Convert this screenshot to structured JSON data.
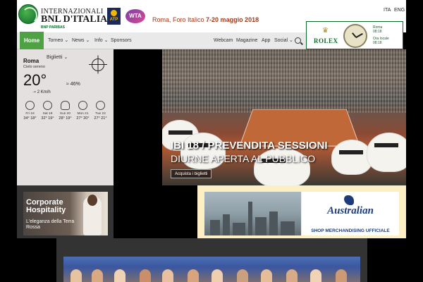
{
  "header": {
    "logo": {
      "line1": "INTERNAZIONALI",
      "line2": "BNL D'ITALIA",
      "line3": "BNP PARIBAS"
    },
    "atp_label": "ATP",
    "wta_label": "WTA",
    "event_city": "Roma",
    "event_venue": ", Foro Italico ",
    "event_dates": "7-20 maggio 2018",
    "languages": [
      "ITA",
      "ENG"
    ]
  },
  "nav": {
    "items": [
      {
        "label": "Home",
        "active": true
      },
      {
        "label": "Torneo ⌄",
        "active": false
      },
      {
        "label": "News ⌄",
        "active": false
      },
      {
        "label": "Info ⌄",
        "active": false
      },
      {
        "label": "Sponsors",
        "active": false
      },
      {
        "label": "Webcam",
        "active": false
      },
      {
        "label": "Magazine",
        "active": false
      },
      {
        "label": "App",
        "active": false
      },
      {
        "label": "Social ⌄",
        "active": false
      }
    ],
    "search_icon": "search-icon"
  },
  "rolex": {
    "brand": "ROLEX",
    "tz1_label": "Roma",
    "tz1_time": "08:18",
    "tz2_label": "Ora locale",
    "tz2_time": "08:18"
  },
  "weather": {
    "city": "Roma",
    "description": "Cielo sereno",
    "temperature": "20°",
    "humidity": "46%",
    "wind": "2 Km/h",
    "forecast": [
      {
        "day": "Fri 18",
        "temps": "34° 18°"
      },
      {
        "day": "Sat 19",
        "temps": "32° 19°"
      },
      {
        "day": "Sun 20",
        "temps": "28° 19°"
      },
      {
        "day": "Mon 21",
        "temps": "27° 20°"
      },
      {
        "day": "Tue 22",
        "temps": "27° 21°"
      }
    ]
  },
  "tickets": {
    "label": "Biglietti"
  },
  "hero": {
    "title": "IBI 18 / PREVENDITA SESSIONI",
    "subtitle": "DIURNE APERTA AL PUBBLICO",
    "button": "Acquista i biglietti"
  },
  "hospitality": {
    "title": "Corporate Hospitality",
    "subtitle": "L'eleganza della Terra Rossa"
  },
  "shop": {
    "brand": "Australian",
    "label": "SHOP MERCHANDISING UFFICIALE"
  },
  "colors": {
    "nav_active": "#4ea244",
    "brand_green": "#0b6b2b",
    "event_text": "#a33a1a"
  }
}
